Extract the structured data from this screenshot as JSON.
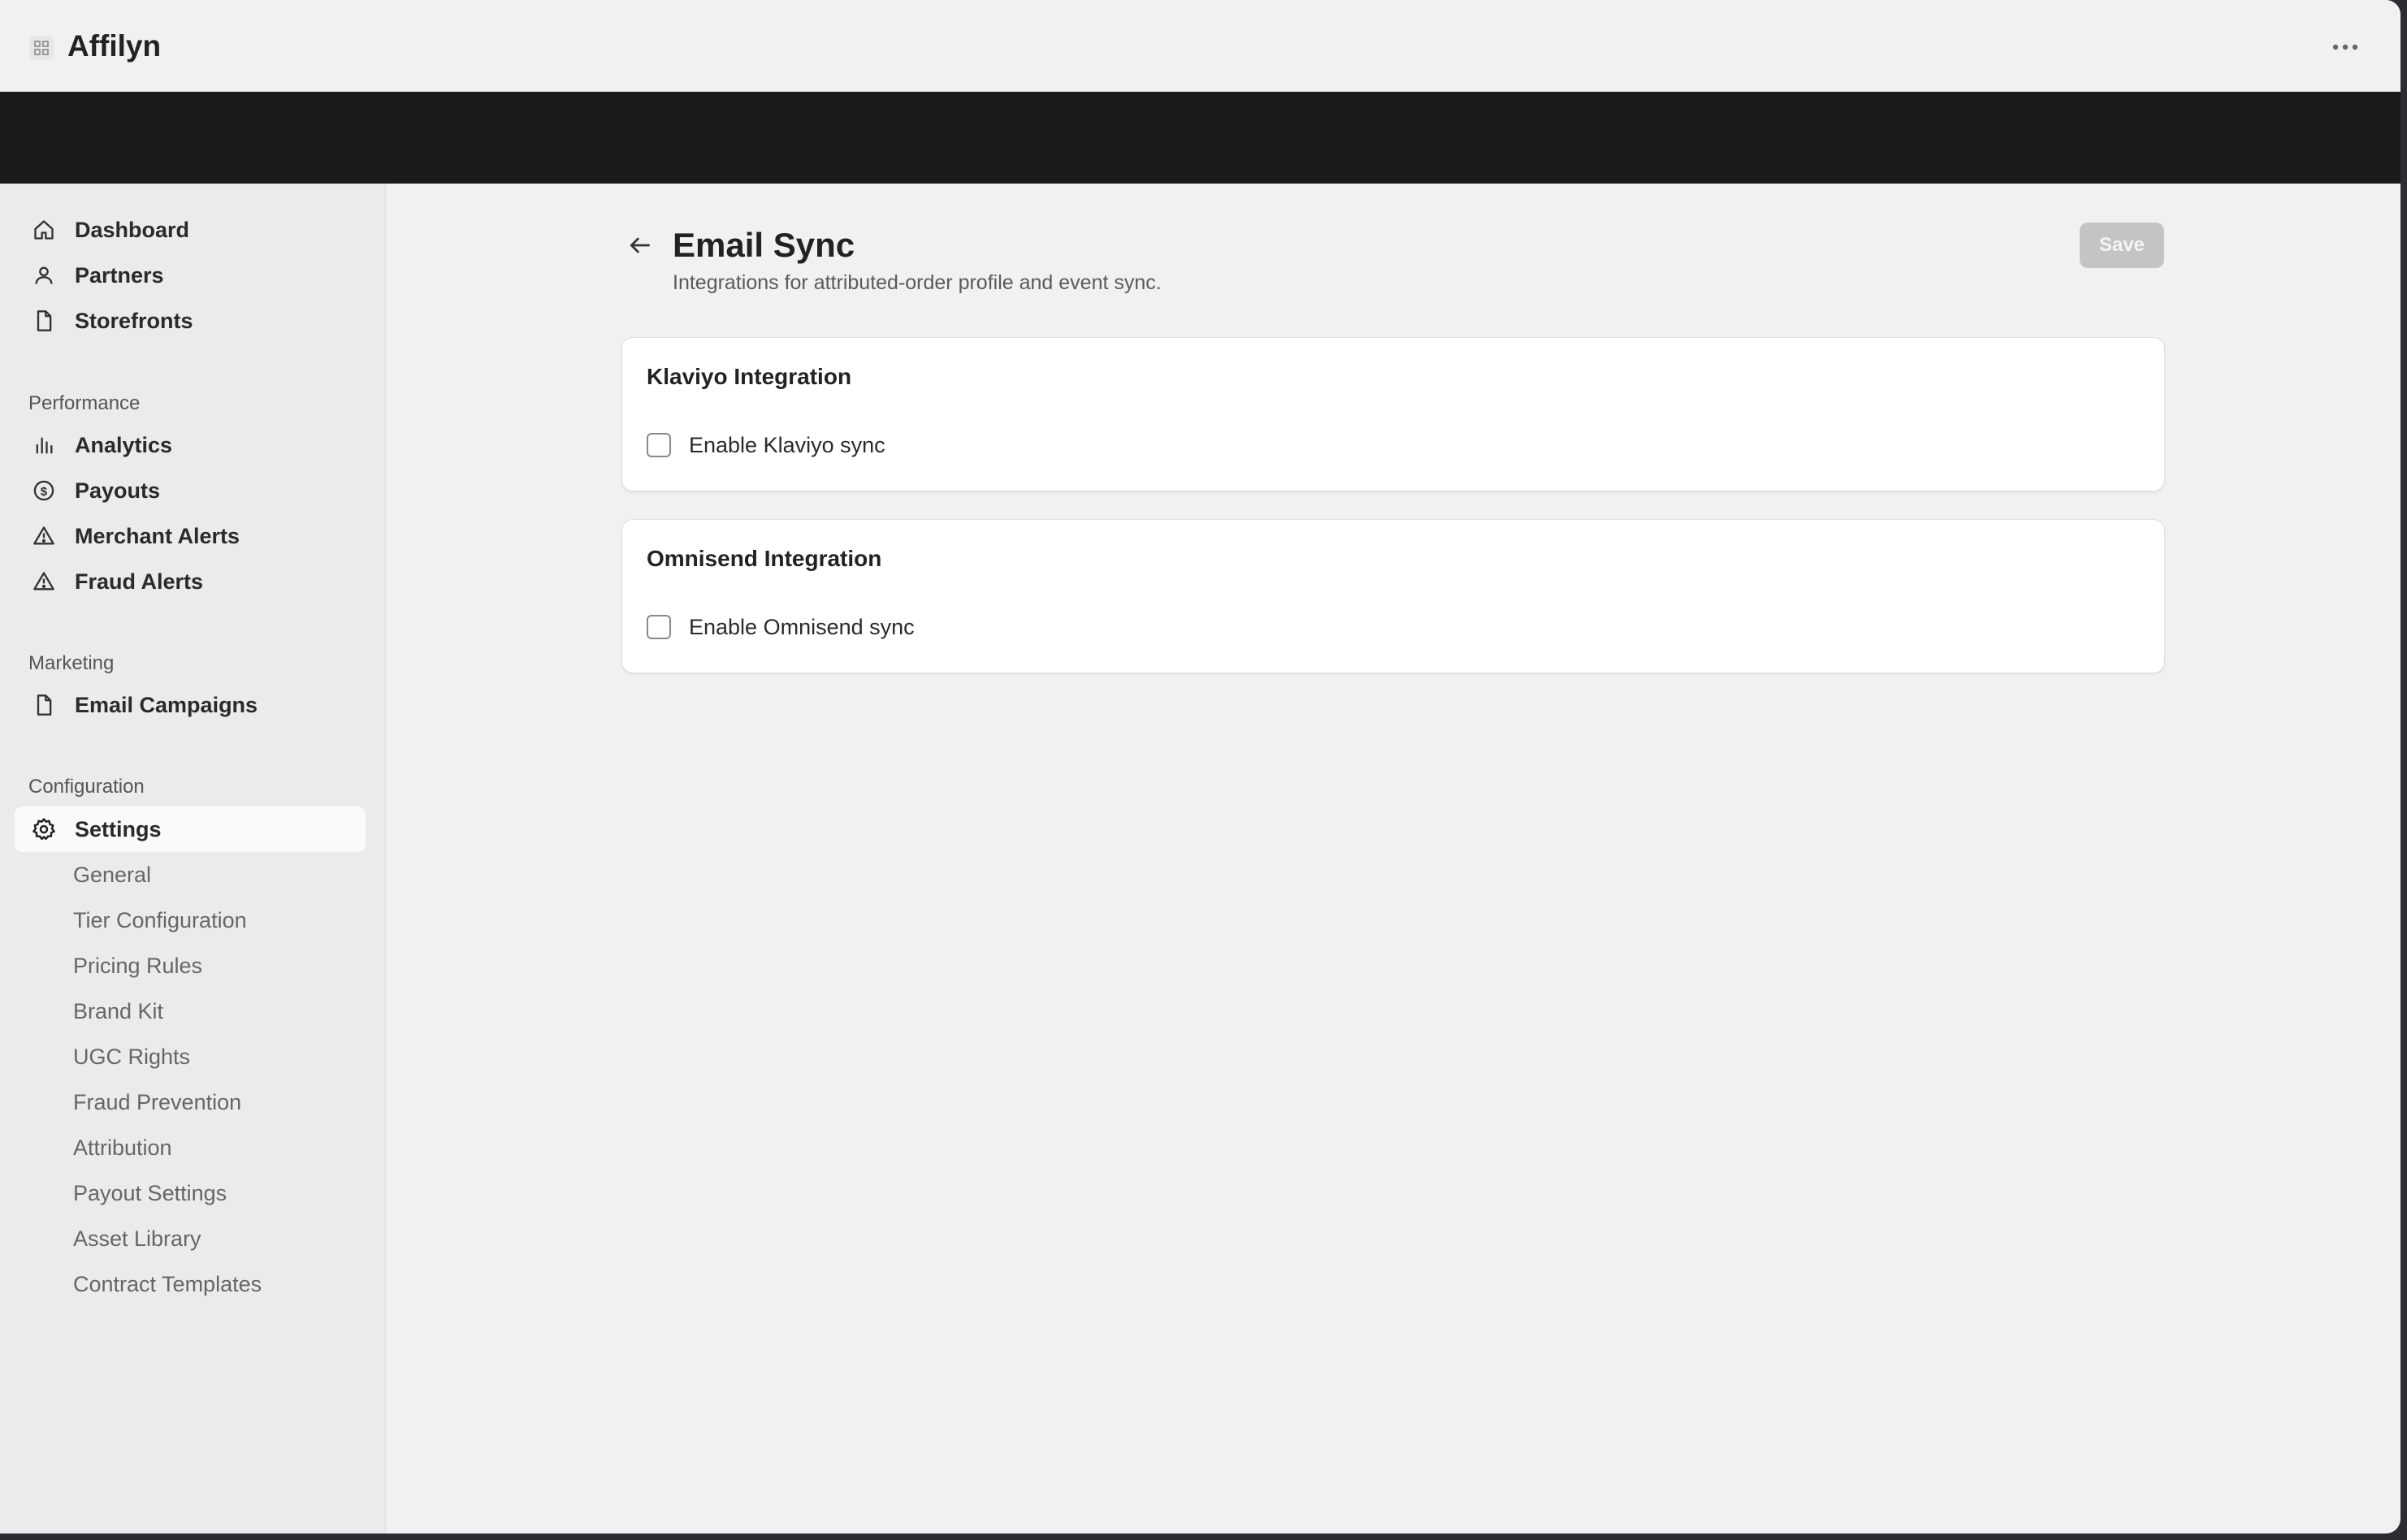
{
  "app": {
    "title": "Affilyn",
    "more_icon": "ellipsis-icon"
  },
  "sidebar": {
    "main_items": [
      {
        "label": "Dashboard",
        "icon": "home-icon"
      },
      {
        "label": "Partners",
        "icon": "user-icon"
      },
      {
        "label": "Storefronts",
        "icon": "file-icon"
      }
    ],
    "sections": {
      "performance": "Performance",
      "marketing": "Marketing",
      "configuration": "Configuration"
    },
    "performance_items": [
      {
        "label": "Analytics",
        "icon": "bar-chart-icon"
      },
      {
        "label": "Payouts",
        "icon": "dollar-circle-icon"
      },
      {
        "label": "Merchant Alerts",
        "icon": "warning-icon"
      },
      {
        "label": "Fraud Alerts",
        "icon": "warning-icon"
      }
    ],
    "marketing_items": [
      {
        "label": "Email Campaigns",
        "icon": "file-icon"
      }
    ],
    "settings": {
      "label": "Settings",
      "icon": "gear-icon",
      "active": true
    },
    "settings_subitems": [
      "General",
      "Tier Configuration",
      "Pricing Rules",
      "Brand Kit",
      "UGC Rights",
      "Fraud Prevention",
      "Attribution",
      "Payout Settings",
      "Asset Library",
      "Contract Templates"
    ]
  },
  "page": {
    "title": "Email Sync",
    "subtitle": "Integrations for attributed-order profile and event sync.",
    "save_label": "Save",
    "back_icon": "arrow-left-icon"
  },
  "cards": [
    {
      "title": "Klaviyo Integration",
      "checkbox_label": "Enable Klaviyo sync",
      "checked": false
    },
    {
      "title": "Omnisend Integration",
      "checkbox_label": "Enable Omnisend sync",
      "checked": false
    }
  ],
  "colors": {
    "background": "#f1f1f1",
    "dark_band": "#1b1b1b",
    "sidebar": "#ebebeb",
    "save_disabled": "#c4c4c4"
  }
}
